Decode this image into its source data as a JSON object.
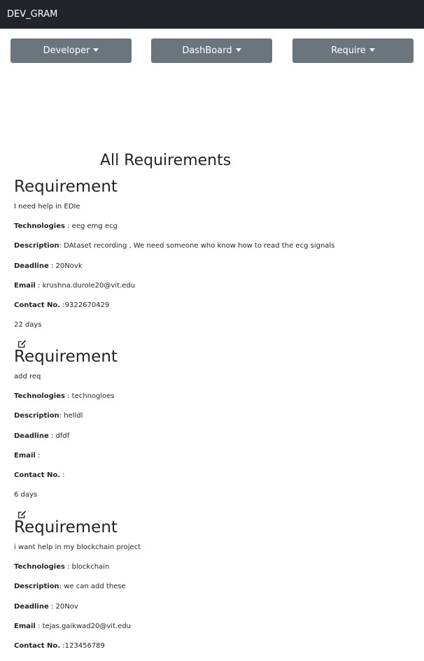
{
  "app": {
    "title": "DEV_GRAM"
  },
  "nav_buttons": [
    {
      "label": "Developer"
    },
    {
      "label": "DashBoard"
    },
    {
      "label": "Require"
    }
  ],
  "page_title": "All Requirements",
  "field_labels": {
    "technologies": "Technologies",
    "description": "Description",
    "deadline": "Deadline",
    "email": "Email",
    "contact": "Contact No."
  },
  "requirements": [
    {
      "heading": "Requirement",
      "subtitle": "I need help in EDIe",
      "technologies": " : eeg emg ecg",
      "description": ": DAtaset recording , We need someone who know how to read the ecg signals",
      "deadline": " : 20Novk",
      "email": " : krushna.durole20@vit.edu",
      "contact": " :9322670429",
      "days": "22 days"
    },
    {
      "heading": "Requirement",
      "subtitle": "add req",
      "technologies": " : technogloes",
      "description": ": helldl",
      "deadline": " : dfdf",
      "email": " :",
      "contact": " :",
      "days": "6 days"
    },
    {
      "heading": "Requirement",
      "subtitle": "i want help in my blockchain project",
      "technologies": " : blockchain",
      "description": ": we can add these",
      "deadline": " : 20Nov",
      "email": " : tejas.gaikwad20@vit.edu",
      "contact": " :123456789"
    }
  ],
  "icons": {
    "edit": "edit-icon",
    "caret": "caret-down-icon"
  }
}
